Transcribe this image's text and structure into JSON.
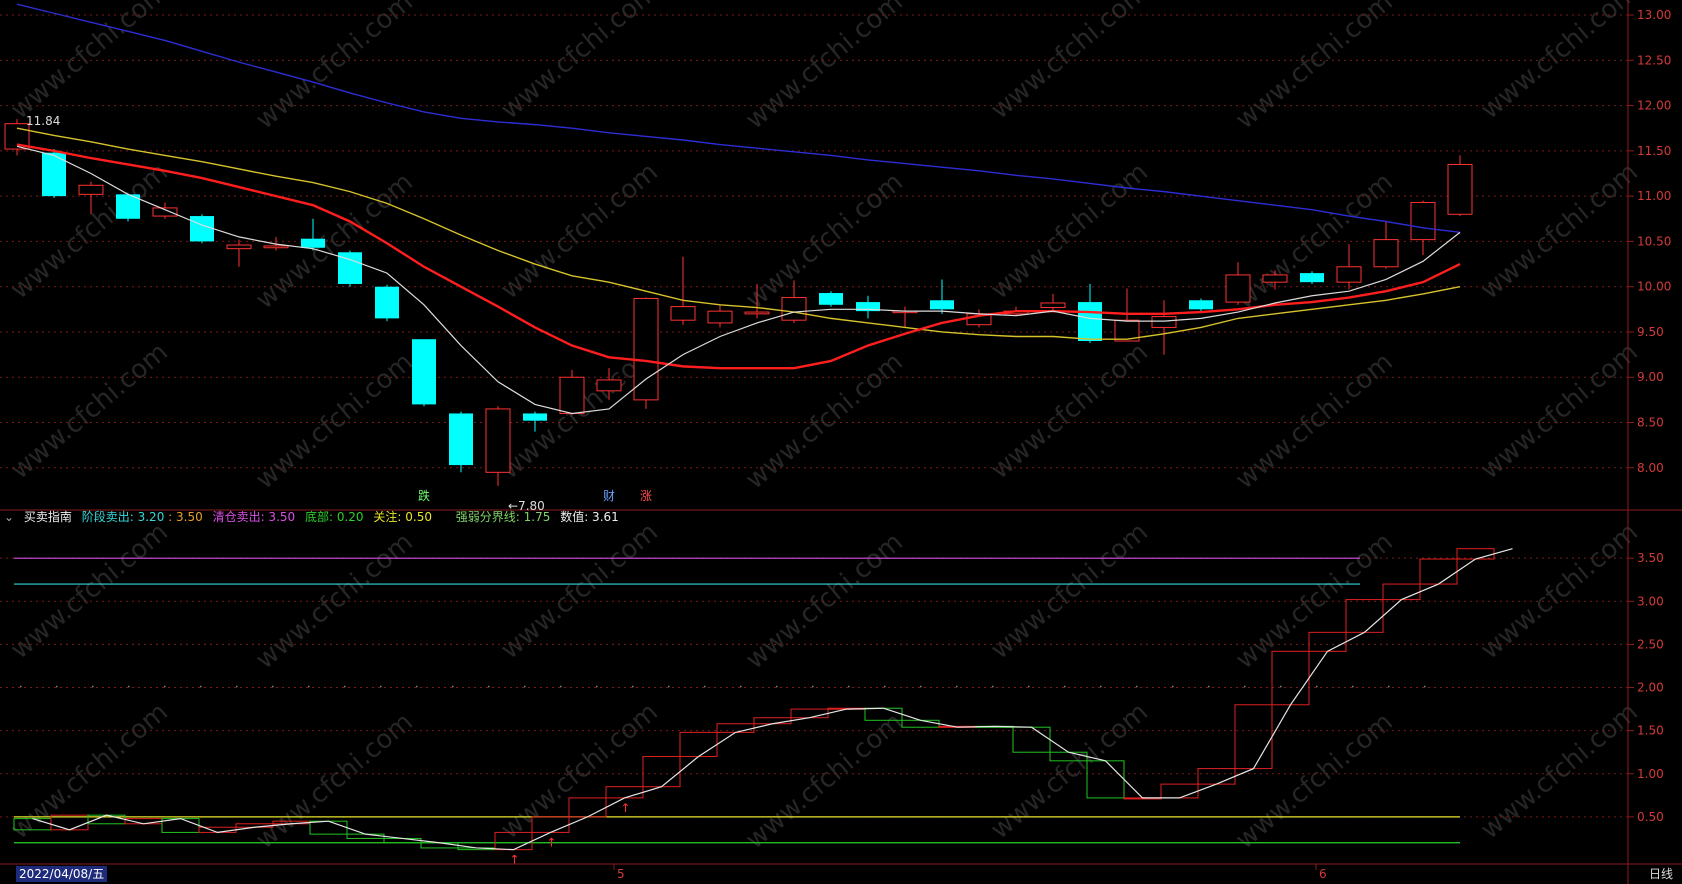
{
  "chart_data": [
    {
      "type": "candlestick",
      "y_ticks": [
        "13.00",
        "12.50",
        "12.00",
        "11.50",
        "11.00",
        "10.50",
        "10.00",
        "9.50",
        "9.00",
        "8.50",
        "8.00"
      ],
      "ylim": [
        7.6,
        13.1
      ],
      "candles": [
        {
          "o": 11.52,
          "c": 11.8,
          "h": 11.85,
          "l": 11.45
        },
        {
          "o": 11.48,
          "c": 11.0,
          "h": 11.52,
          "l": 10.98
        },
        {
          "o": 11.02,
          "c": 11.12,
          "h": 11.16,
          "l": 10.8
        },
        {
          "o": 11.02,
          "c": 10.75,
          "h": 11.03,
          "l": 10.72
        },
        {
          "o": 10.78,
          "c": 10.87,
          "h": 10.93,
          "l": 10.75
        },
        {
          "o": 10.78,
          "c": 10.5,
          "h": 10.8,
          "l": 10.48
        },
        {
          "o": 10.42,
          "c": 10.46,
          "h": 10.52,
          "l": 10.22
        },
        {
          "o": 10.43,
          "c": 10.45,
          "h": 10.55,
          "l": 10.4
        },
        {
          "o": 10.53,
          "c": 10.43,
          "h": 10.75,
          "l": 10.4
        },
        {
          "o": 10.38,
          "c": 10.03,
          "h": 10.4,
          "l": 10.0
        },
        {
          "o": 10.0,
          "c": 9.65,
          "h": 10.02,
          "l": 9.62
        },
        {
          "o": 9.42,
          "c": 8.7,
          "h": 9.42,
          "l": 8.68
        },
        {
          "o": 8.6,
          "c": 8.03,
          "h": 8.62,
          "l": 7.95
        },
        {
          "o": 7.95,
          "c": 8.65,
          "h": 8.68,
          "l": 7.8
        },
        {
          "o": 8.6,
          "c": 8.52,
          "h": 8.62,
          "l": 8.4
        },
        {
          "o": 8.6,
          "c": 9.0,
          "h": 9.08,
          "l": 8.58
        },
        {
          "o": 8.85,
          "c": 8.97,
          "h": 9.1,
          "l": 8.75
        },
        {
          "o": 8.75,
          "c": 9.87,
          "h": 9.88,
          "l": 8.65
        },
        {
          "o": 9.63,
          "c": 9.78,
          "h": 10.33,
          "l": 9.58
        },
        {
          "o": 9.6,
          "c": 9.73,
          "h": 9.8,
          "l": 9.55
        },
        {
          "o": 9.7,
          "c": 9.72,
          "h": 10.03,
          "l": 9.65
        },
        {
          "o": 9.63,
          "c": 9.88,
          "h": 10.07,
          "l": 9.6
        },
        {
          "o": 9.93,
          "c": 9.8,
          "h": 9.95,
          "l": 9.78
        },
        {
          "o": 9.83,
          "c": 9.73,
          "h": 9.9,
          "l": 9.65
        },
        {
          "o": 9.72,
          "c": 9.73,
          "h": 9.78,
          "l": 9.55
        },
        {
          "o": 9.85,
          "c": 9.75,
          "h": 10.08,
          "l": 9.7
        },
        {
          "o": 9.58,
          "c": 9.7,
          "h": 9.75,
          "l": 9.55
        },
        {
          "o": 9.7,
          "c": 9.73,
          "h": 9.78,
          "l": 9.68
        },
        {
          "o": 9.77,
          "c": 9.82,
          "h": 9.92,
          "l": 9.72
        },
        {
          "o": 9.83,
          "c": 9.4,
          "h": 10.03,
          "l": 9.38
        },
        {
          "o": 9.4,
          "c": 9.63,
          "h": 9.98,
          "l": 9.4
        },
        {
          "o": 9.55,
          "c": 9.67,
          "h": 9.85,
          "l": 9.25
        },
        {
          "o": 9.85,
          "c": 9.75,
          "h": 9.87,
          "l": 9.72
        },
        {
          "o": 9.83,
          "c": 10.13,
          "h": 10.27,
          "l": 9.8
        },
        {
          "o": 10.05,
          "c": 10.13,
          "h": 10.18,
          "l": 9.97
        },
        {
          "o": 10.15,
          "c": 10.05,
          "h": 10.17,
          "l": 10.03
        },
        {
          "o": 10.05,
          "c": 10.22,
          "h": 10.47,
          "l": 9.97
        },
        {
          "o": 10.22,
          "c": 10.52,
          "h": 10.72,
          "l": 10.2
        },
        {
          "o": 10.52,
          "c": 10.93,
          "h": 10.95,
          "l": 10.35
        },
        {
          "o": 10.8,
          "c": 11.35,
          "h": 11.45,
          "l": 10.78
        }
      ],
      "ma_white": [
        11.55,
        11.45,
        11.25,
        11.02,
        10.85,
        10.68,
        10.55,
        10.47,
        10.42,
        10.3,
        10.15,
        9.8,
        9.35,
        8.95,
        8.7,
        8.6,
        8.65,
        8.98,
        9.25,
        9.45,
        9.6,
        9.72,
        9.75,
        9.75,
        9.73,
        9.73,
        9.7,
        9.68,
        9.73,
        9.65,
        9.62,
        9.62,
        9.65,
        9.72,
        9.82,
        9.9,
        9.95,
        10.08,
        10.28,
        10.6
      ],
      "ma_red": [
        11.57,
        11.5,
        11.42,
        11.35,
        11.28,
        11.2,
        11.1,
        11.0,
        10.9,
        10.72,
        10.48,
        10.22,
        10.0,
        9.78,
        9.55,
        9.35,
        9.22,
        9.18,
        9.12,
        9.1,
        9.1,
        9.1,
        9.18,
        9.35,
        9.48,
        9.6,
        9.68,
        9.73,
        9.73,
        9.72,
        9.7,
        9.7,
        9.72,
        9.75,
        9.8,
        9.83,
        9.88,
        9.95,
        10.05,
        10.25
      ],
      "ma_yellow": [
        11.75,
        11.67,
        11.6,
        11.52,
        11.45,
        11.38,
        11.3,
        11.22,
        11.15,
        11.05,
        10.92,
        10.75,
        10.57,
        10.4,
        10.25,
        10.12,
        10.05,
        9.95,
        9.85,
        9.8,
        9.77,
        9.72,
        9.65,
        9.6,
        9.55,
        9.5,
        9.47,
        9.45,
        9.45,
        9.42,
        9.42,
        9.48,
        9.55,
        9.65,
        9.7,
        9.75,
        9.8,
        9.85,
        9.92,
        10.0
      ],
      "ma_blue": [
        13.12,
        13.02,
        12.92,
        12.82,
        12.72,
        12.6,
        12.48,
        12.37,
        12.26,
        12.14,
        12.03,
        11.93,
        11.86,
        11.82,
        11.79,
        11.75,
        11.7,
        11.66,
        11.62,
        11.57,
        11.53,
        11.49,
        11.45,
        11.4,
        11.36,
        11.32,
        11.28,
        11.23,
        11.19,
        11.14,
        11.09,
        11.05,
        11.0,
        10.95,
        10.9,
        10.85,
        10.78,
        10.72,
        10.65,
        10.6
      ],
      "annotations": {
        "high_label": "11.84",
        "low_label": "←7.80"
      },
      "events": [
        {
          "index": 11,
          "text": "跌",
          "color": "#6dff6d"
        },
        {
          "index": 16,
          "text": "财",
          "color": "#6aa0ff"
        },
        {
          "index": 17,
          "text": "涨",
          "color": "#ff4d4d"
        }
      ]
    },
    {
      "type": "line",
      "name": "买卖指南",
      "y_ticks": [
        "3.50",
        "3.00",
        "2.50",
        "2.00",
        "1.50",
        "1.00",
        "0.50"
      ],
      "ylim": [
        0.0,
        3.85
      ],
      "values": [
        0.48,
        0.35,
        0.52,
        0.42,
        0.48,
        0.32,
        0.38,
        0.42,
        0.45,
        0.3,
        0.25,
        0.2,
        0.14,
        0.12,
        0.32,
        0.5,
        0.72,
        0.85,
        1.2,
        1.48,
        1.58,
        1.65,
        1.75,
        1.76,
        1.62,
        1.54,
        1.55,
        1.54,
        1.25,
        1.15,
        0.72,
        0.72,
        0.88,
        1.06,
        1.8,
        2.42,
        2.64,
        3.02,
        3.2,
        3.49,
        3.61
      ],
      "reference_lines": [
        {
          "value": 3.5,
          "color": "#d94ee6"
        },
        {
          "value": 3.2,
          "color": "#35d7d7"
        },
        {
          "value": 0.5,
          "color": "#e6e62a"
        },
        {
          "value": 0.2,
          "color": "#2ad02a"
        }
      ]
    }
  ],
  "indicator_header": {
    "name": "买卖指南",
    "stage_sell_label": "阶段卖出:",
    "stage_sell_v1": "3.20",
    "stage_sell_sep": ":",
    "stage_sell_v2": "3.50",
    "clear_sell": "清仓卖出: 3.50",
    "bottom": "底部: 0.20",
    "focus": "关注: 0.50",
    "divide": "强弱分界线: 1.75",
    "value": "数值: 3.61"
  },
  "x_axis": {
    "date": "2022/04/08/五",
    "marks": [
      "5",
      "6"
    ],
    "period": "日线"
  },
  "colors": {
    "up": "#ff3232",
    "down": "#00ffff",
    "grid": "#7a1a1a",
    "axis": "#8b1c1c",
    "ma_white": "#dcdcdc",
    "ma_red": "#ff1e1e",
    "ma_yellow": "#d6c22a",
    "ma_blue": "#2d2dd6"
  },
  "watermark": "www.cfchi.com"
}
